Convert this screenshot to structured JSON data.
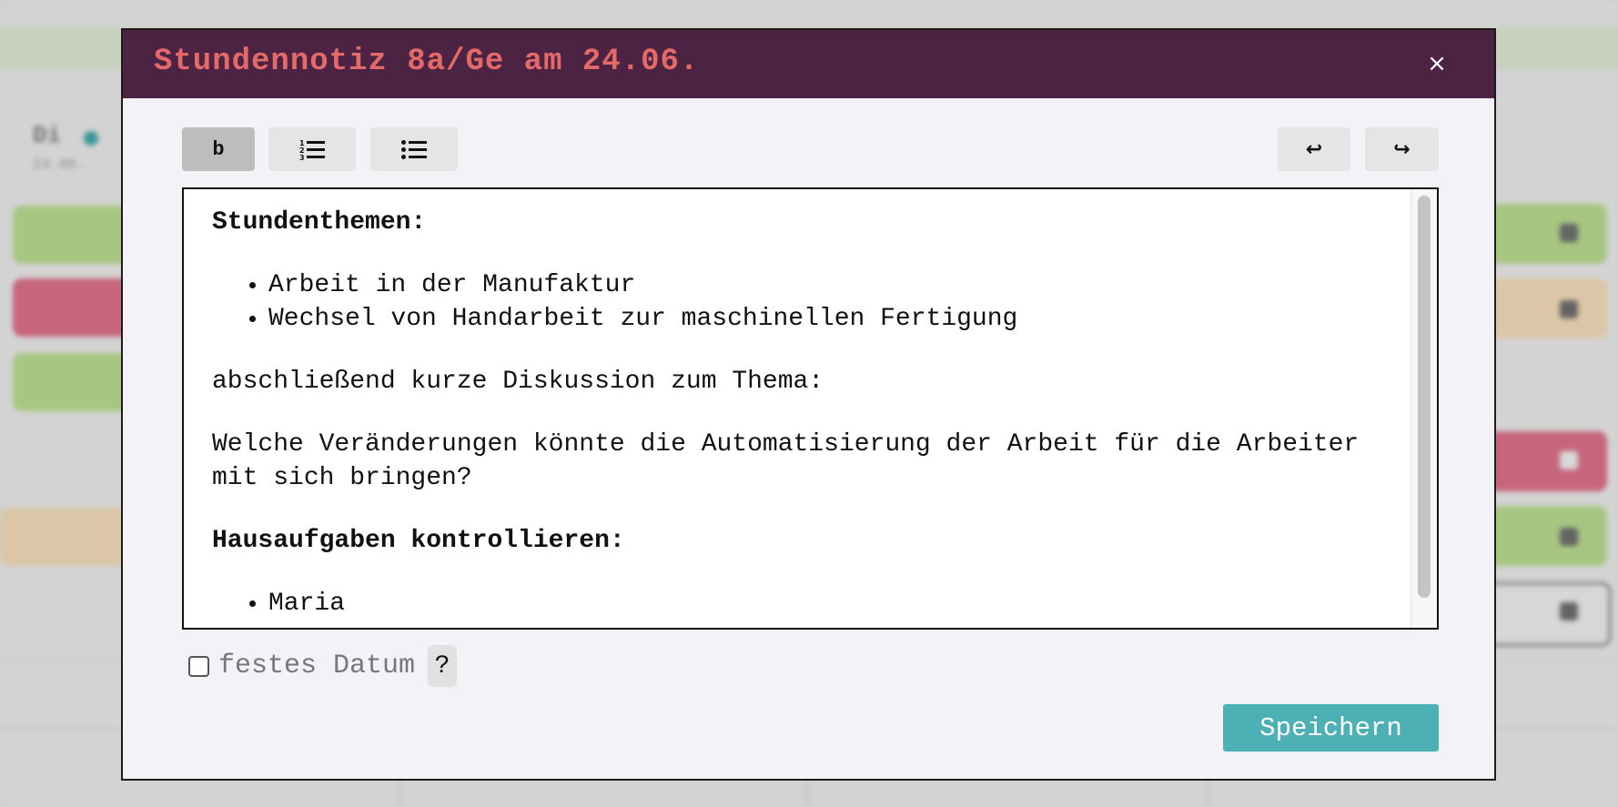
{
  "modal": {
    "title": "Stundennotiz 8a/Ge am 24.06.",
    "close_label": "×"
  },
  "toolbar": {
    "bold_label": "b",
    "ordered_list_icon": "ordered-list-icon",
    "bullet_list_icon": "bullet-list-icon",
    "undo_label": "↩",
    "redo_label": "↪"
  },
  "editor": {
    "heading1": "Stundenthemen:",
    "list1": [
      "Arbeit in der Manufaktur",
      "Wechsel von Handarbeit zur maschinellen Fertigung"
    ],
    "paragraph1": "abschließend kurze Diskussion zum Thema:",
    "paragraph2": "Welche Veränderungen könnte die Automatisierung der Arbeit für die Arbeiter mit sich bringen?",
    "heading2": "Hausaufgaben kontrollieren:",
    "list2": [
      "Maria"
    ]
  },
  "options": {
    "fixed_date_label": "festes Datum",
    "fixed_date_checked": false,
    "help_label": "?"
  },
  "actions": {
    "save_label": "Speichern"
  },
  "background": {
    "day_label": "Di",
    "date_label": "24.06."
  },
  "colors": {
    "header_bg": "#4c2342",
    "title": "#e46a6a",
    "save_button": "#4cb0b4"
  }
}
